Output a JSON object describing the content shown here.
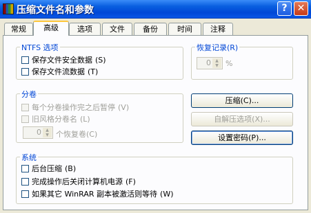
{
  "window": {
    "title": "压缩文件名和参数",
    "help": "?",
    "close": "✕"
  },
  "tabs": [
    "常规",
    "高级",
    "选项",
    "文件",
    "备份",
    "时间",
    "注释"
  ],
  "ntfs": {
    "title": "NTFS 选项",
    "items": [
      {
        "label": "保存文件安全数据",
        "key": "(S)",
        "checked": false
      },
      {
        "label": "保存文件流数据",
        "key": "(T)",
        "checked": false
      }
    ]
  },
  "recovery": {
    "title": "恢复记录",
    "title_key": "(R)",
    "value": "0",
    "unit": "%"
  },
  "volume": {
    "title": "分卷",
    "items": [
      {
        "label": "每个分卷操作完之后暂停",
        "key": "(V)"
      },
      {
        "label": "旧风格分卷名",
        "key": "(L)"
      }
    ],
    "spin_value": "0",
    "spin_label": "个恢复卷",
    "spin_key": "(C)"
  },
  "buttons": {
    "compress": "压缩(C)...",
    "sfx": "自解压选项(X)...",
    "password": "设置密码(P)..."
  },
  "system": {
    "title": "系统",
    "items": [
      {
        "label": "后台压缩",
        "key": "(B)"
      },
      {
        "label": "完成操作后关闭计算机电源",
        "key": "(F)"
      },
      {
        "label": "如果其它 WinRAR 副本被激活则等待",
        "key": "(W)"
      }
    ]
  }
}
